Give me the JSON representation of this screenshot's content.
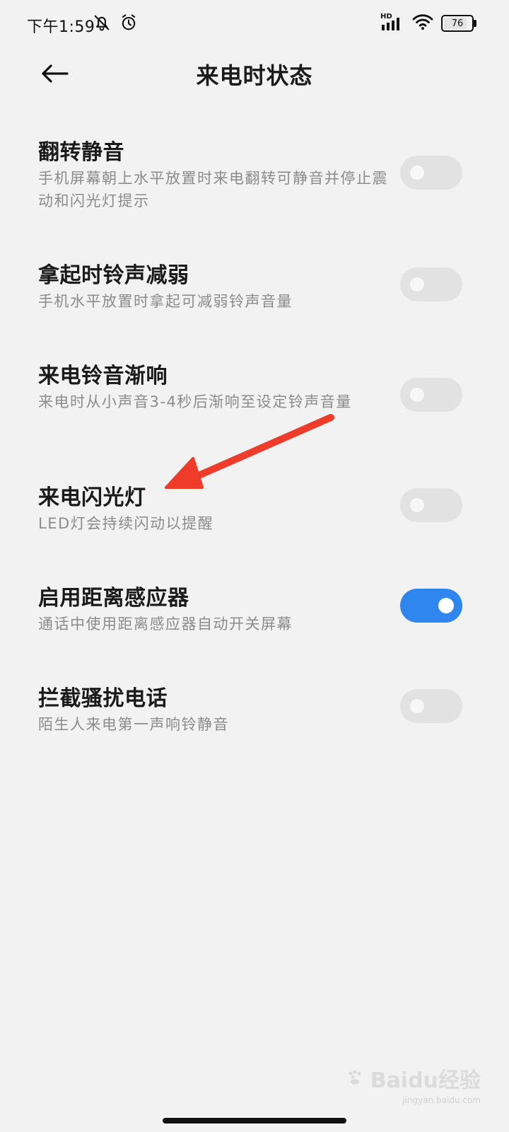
{
  "status_bar": {
    "time": "下午1:59",
    "network": "HD",
    "battery": "76",
    "battery_level": 0.76,
    "icons": [
      "bell-muted-icon",
      "alarm-icon",
      "signal-icon",
      "wifi-icon",
      "battery-icon"
    ]
  },
  "header": {
    "title": "来电时状态",
    "back_icon": "back-arrow-icon"
  },
  "settings": [
    {
      "title": "翻转静音",
      "desc": "手机屏幕朝上水平放置时来电翻转可静音并停止震动和闪光灯提示",
      "enabled": false
    },
    {
      "title": "拿起时铃声减弱",
      "desc": "手机水平放置时拿起可减弱铃声音量",
      "enabled": false
    },
    {
      "title": "来电铃音渐响",
      "desc": "来电时从小声音3-4秒后渐响至设定铃声音量",
      "enabled": false
    },
    {
      "title": "来电闪光灯",
      "desc": "LED灯会持续闪动以提醒",
      "enabled": false
    },
    {
      "title": "启用距离感应器",
      "desc": "通话中使用距离感应器自动开关屏幕",
      "enabled": true
    },
    {
      "title": "拦截骚扰电话",
      "desc": "陌生人来电第一声响铃静音",
      "enabled": false
    }
  ],
  "colors": {
    "background": "#f2f2f2",
    "toggle_on": "#2f86ee",
    "toggle_off": "#e2e2e2",
    "annotation_arrow": "#ee3b2a"
  },
  "watermark": {
    "text": "Baidu经验",
    "subtext": "jingyan.baidu.com"
  }
}
